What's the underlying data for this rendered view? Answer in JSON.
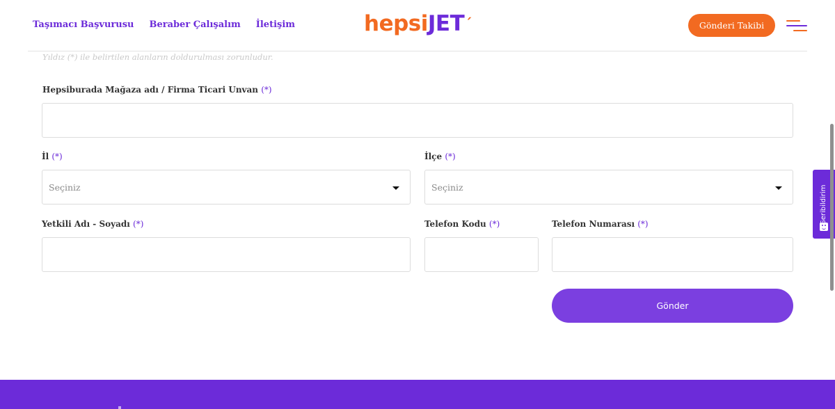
{
  "header": {
    "nav": [
      {
        "label": "Taşımacı Başvurusu"
      },
      {
        "label": "Beraber Çalışalım"
      },
      {
        "label": "İletişim"
      }
    ],
    "logo": {
      "part1": "hepsi",
      "part2": "JET",
      "mark": "´"
    },
    "track_button": "Gönderi Takibi",
    "menu_icon": "hamburger-menu-icon"
  },
  "form": {
    "required_note": "Yıldız (*) ile belirtilen alanların doldurulması zorunludur.",
    "fields": {
      "store_name": {
        "label": "Hepsiburada Mağaza adı / Firma Ticari Unvan",
        "req": "(*)",
        "value": ""
      },
      "city": {
        "label": "İl",
        "req": "(*)",
        "placeholder": "Seçiniz"
      },
      "district": {
        "label": "İlçe",
        "req": "(*)",
        "placeholder": "Seçiniz"
      },
      "contact_name": {
        "label": "Yetkili Adı - Soyadı",
        "req": "(*)",
        "value": ""
      },
      "phone_code": {
        "label": "Telefon Kodu",
        "req": "(*)",
        "value": ""
      },
      "phone_number": {
        "label": "Telefon Numarası",
        "req": "(*)",
        "value": ""
      }
    },
    "submit_label": "Gönder"
  },
  "feedback_tab": {
    "label": "Geribildirim",
    "icon": "smiley-icon"
  },
  "colors": {
    "brand_orange": "#f26a21",
    "brand_purple": "#6c2bd9",
    "button_purple": "#7b3fe0"
  }
}
